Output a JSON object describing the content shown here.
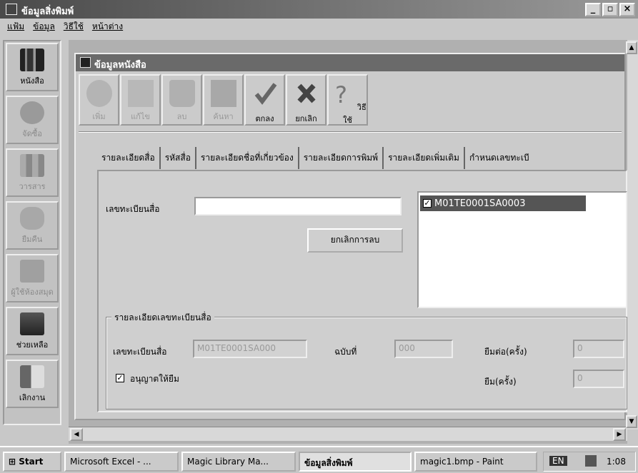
{
  "window": {
    "title": "ข้อมูลสิ่งพิมพ์",
    "controls": [
      "_",
      "▫",
      "×"
    ]
  },
  "menu": [
    "แฟ้ม",
    "ข้อมูล",
    "วิธีใช้",
    "หน้าต่าง"
  ],
  "sidebar": {
    "items": [
      {
        "label": "หนังสือ",
        "icon": "books-icon",
        "enabled": true
      },
      {
        "label": "จัดซื้อ",
        "icon": "purchase-icon",
        "enabled": false
      },
      {
        "label": "วารสาร",
        "icon": "journal-icon",
        "enabled": false
      },
      {
        "label": "ยืมคืน",
        "icon": "circulation-icon",
        "enabled": false
      },
      {
        "label": "ผู้ใช้ห้องสมุด",
        "icon": "members-icon",
        "enabled": false
      },
      {
        "label": "ช่วยเหลือ",
        "icon": "help-icon",
        "enabled": true
      },
      {
        "label": "เลิกงาน",
        "icon": "exit-icon",
        "enabled": true
      }
    ]
  },
  "child": {
    "title": "ข้อมูลหนังสือ",
    "toolbar": [
      {
        "label": "เพิ่ม",
        "icon": "add-icon",
        "enabled": false
      },
      {
        "label": "แก้ไข",
        "icon": "edit-icon",
        "enabled": false
      },
      {
        "label": "ลบ",
        "icon": "trash-icon",
        "enabled": false
      },
      {
        "label": "ค้นหา",
        "icon": "search-icon",
        "enabled": false
      },
      {
        "label": "ตกลง",
        "icon": "check-icon",
        "enabled": true
      },
      {
        "label": "ยกเลิก",
        "icon": "cancel-icon",
        "enabled": true
      },
      {
        "label": "วิธีใช้",
        "icon": "question-icon",
        "enabled": true
      }
    ],
    "tabs": [
      "รายละเอียดสื่อ",
      "รหัสสื่อ",
      "รายละเอียดชื่อที่เกี่ยวข้อง",
      "รายละเอียดการพิมพ์",
      "รายละเอียดเพิ่มเติม",
      "กำหนดเลขทะเบี"
    ],
    "form": {
      "reg_label": "เลขทะเบียนสื่อ",
      "reg_value": "",
      "undelete_button": "ยกเลิกการลบ",
      "list_items": [
        "M01TE0001SA0003"
      ],
      "group_title": "รายละเอียดเลขทะเบียนสื่อ",
      "detail_reg_label": "เลขทะเบียนสื่อ",
      "detail_reg_value": "M01TE0001SA000",
      "copy_label": "ฉบับที่",
      "copy_value": "000",
      "renew_label": "ยืมต่อ(ครั้ง)",
      "renew_value": "0",
      "borrow_label": "ยืม(ครั้ง)",
      "borrow_value": "0",
      "allow_borrow_label": "อนุญาตให้ยืม",
      "allow_borrow_checked": true
    }
  },
  "taskbar": {
    "start": "Start",
    "tasks": [
      "Microsoft Excel - ...",
      "Magic Library Ma...",
      "ข้อมูลสิ่งพิมพ์",
      "magic1.bmp - Paint"
    ],
    "tray_lang": "EN",
    "clock": "1:08"
  }
}
